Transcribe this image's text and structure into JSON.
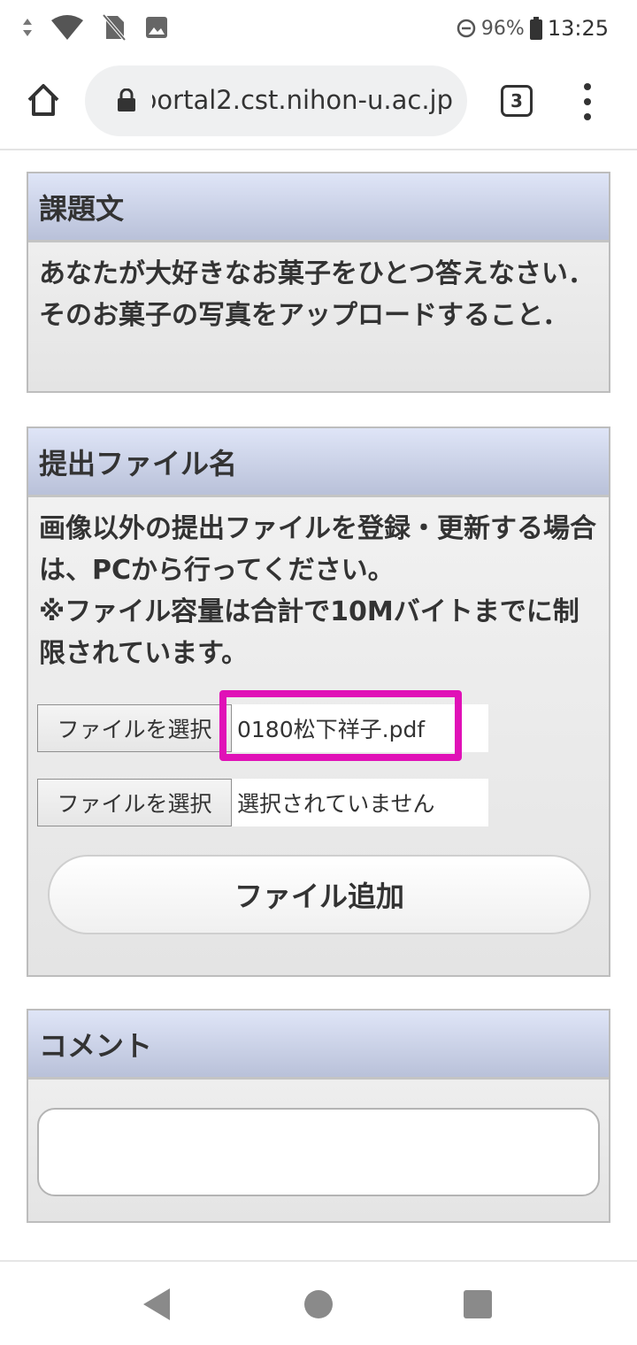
{
  "status_bar": {
    "battery": "96%",
    "time": "13:25",
    "icons": [
      "signal-arrows-icon",
      "wifi-icon",
      "no-sim-icon",
      "image-icon",
      "dnd-icon",
      "battery-icon"
    ]
  },
  "browser": {
    "url": "portal2.cst.nihon-u.ac.jp",
    "tab_count": "3",
    "icons": [
      "home-icon",
      "lock-icon",
      "menu-dots-icon"
    ]
  },
  "assignment": {
    "title": "課題文",
    "text": "あなたが大好きなお菓子をひとつ答えなさい．そのお菓子の写真をアップロードすること．"
  },
  "upload": {
    "title": "提出ファイル名",
    "notice": "画像以外の提出ファイルを登録・更新する場合は、PCから行ってください。",
    "notice2": "※ファイル容量は合計で10Mバイトまでに制限されています。",
    "files": [
      {
        "button": "ファイルを選択",
        "name": "0180松下祥子.pdf"
      },
      {
        "button": "ファイルを選択",
        "name": "選択されていません"
      }
    ],
    "add_button": "ファイル追加",
    "highlight_color": "#e011b7"
  },
  "comment": {
    "title": "コメント",
    "value": ""
  },
  "nav": {
    "icons": [
      "back-icon",
      "home-circle-icon",
      "recents-icon"
    ]
  }
}
